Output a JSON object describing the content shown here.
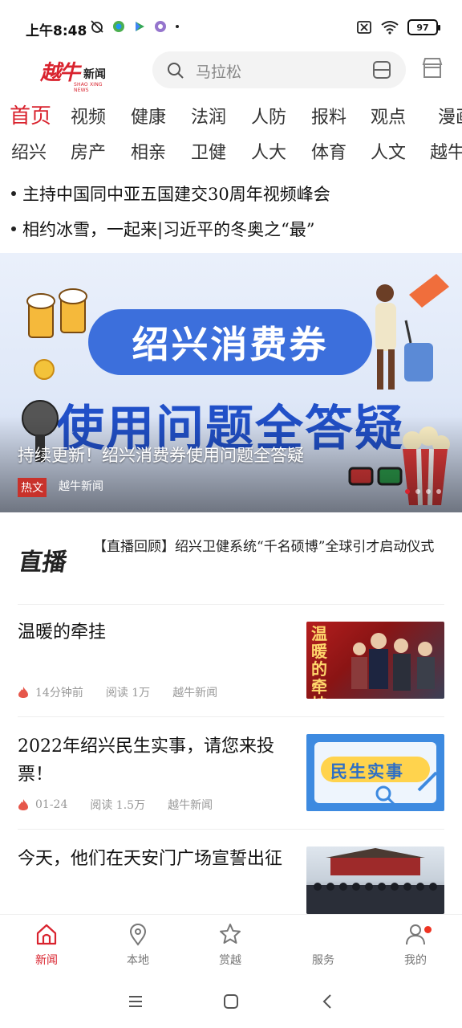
{
  "status": {
    "time": "上午8:48",
    "battery": "97"
  },
  "header": {
    "logo_main": "越牛",
    "logo_cn": "新闻",
    "logo_en": "SHAO XING NEWS",
    "search_placeholder": "马拉松"
  },
  "tabs_row1": [
    "首页",
    "视频",
    "健康",
    "法润",
    "人防",
    "报料",
    "观点",
    "漫画"
  ],
  "tabs_row2": [
    "绍兴",
    "房产",
    "相亲",
    "卫健",
    "人大",
    "体育",
    "人文",
    "越牛"
  ],
  "headlines": [
    "主持中国同中亚五国建交30周年视频峰会",
    "相约冰雪，一起来|习近平的冬奥之“最”"
  ],
  "banner": {
    "pill_text": "绍兴消费券",
    "big_title": "使用问题全答疑",
    "caption": "持续更新！绍兴消费券使用问题全答疑",
    "tag": "热文",
    "source": "越牛新闻"
  },
  "live": {
    "icon_label": "直播",
    "text": "【直播回顾】绍兴卫健系统“千名硕博”全球引才启动仪式"
  },
  "news": [
    {
      "title": "温暖的牵挂",
      "time": "14分钟前",
      "reads": "阅读 1万",
      "source": "越牛新闻",
      "thumb_text": "温暖的牵挂"
    },
    {
      "title": "2022年绍兴民生实事，请您来投票！",
      "time": "01-24",
      "reads": "阅读 1.5万",
      "source": "越牛新闻",
      "thumb_text": "民生实事"
    },
    {
      "title": "今天，他们在天安门广场宣誓出征",
      "time": "",
      "reads": "",
      "source": "",
      "thumb_text": ""
    }
  ],
  "bottom_nav": [
    {
      "label": "新闻",
      "icon": "home-icon",
      "active": true
    },
    {
      "label": "本地",
      "icon": "location-pin-icon",
      "active": false
    },
    {
      "label": "赏越",
      "icon": "star-icon",
      "active": false
    },
    {
      "label": "服务",
      "icon": "grid-icon",
      "active": false
    },
    {
      "label": "我的",
      "icon": "person-icon",
      "active": false
    }
  ],
  "colors": {
    "accent": "#d9232e",
    "banner_blue": "#3c6fdc"
  }
}
